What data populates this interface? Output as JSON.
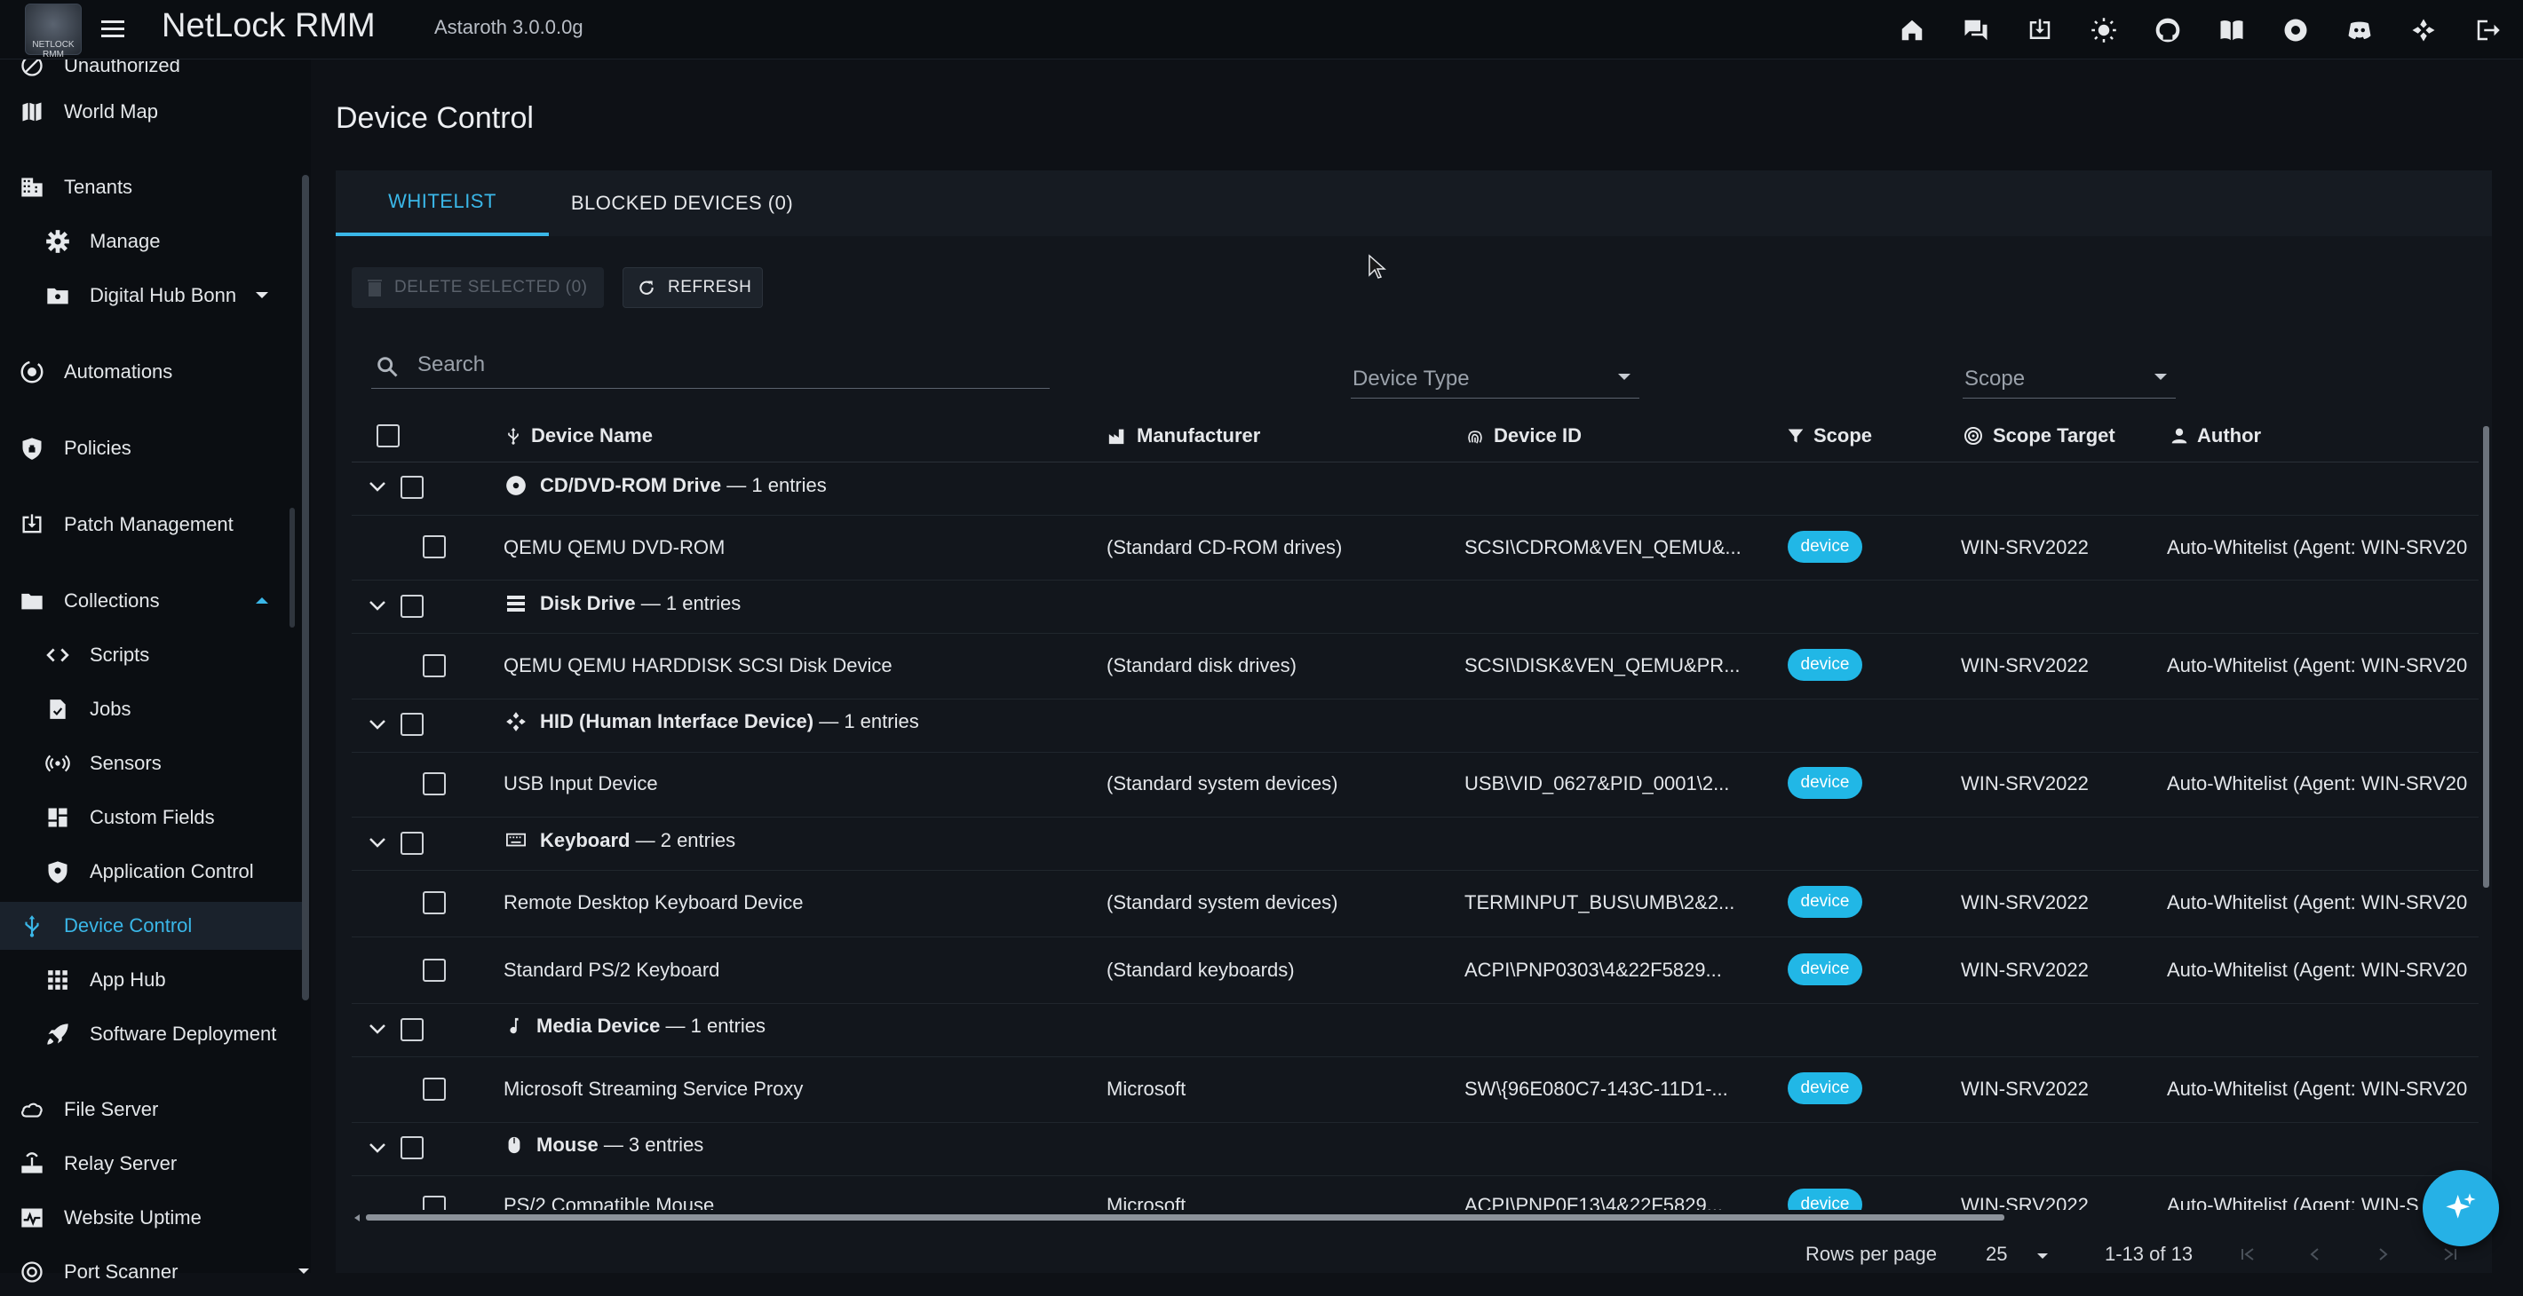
{
  "app": {
    "title": "NetLock RMM",
    "version": "Astaroth 3.0.0.0g",
    "logo_text": "NETLOCK RMM"
  },
  "colors": {
    "accent": "#3ab7e8",
    "badge": "#21b7e6",
    "background": "#0e1116"
  },
  "top_icons": [
    "home-icon",
    "chat-icon",
    "download-icon",
    "theme-icon",
    "github-icon",
    "docs-icon",
    "support-icon",
    "discord-icon",
    "members-icon",
    "logout-icon"
  ],
  "sidebar": {
    "items": [
      {
        "label": "Unauthorized",
        "icon": "unauthorized-icon"
      },
      {
        "label": "World Map",
        "icon": "map-icon"
      },
      {
        "label": "Tenants",
        "icon": "building-icon"
      },
      {
        "label": "Manage",
        "icon": "gear-icon"
      },
      {
        "label": "Digital Hub Bonn",
        "icon": "folder-icon"
      },
      {
        "label": "Automations",
        "icon": "automation-icon"
      },
      {
        "label": "Policies",
        "icon": "shield-icon"
      },
      {
        "label": "Patch Management",
        "icon": "patch-icon"
      },
      {
        "label": "Collections",
        "icon": "folder-icon"
      },
      {
        "label": "Scripts",
        "icon": "code-icon"
      },
      {
        "label": "Jobs",
        "icon": "jobs-icon"
      },
      {
        "label": "Sensors",
        "icon": "sensor-icon"
      },
      {
        "label": "Custom Fields",
        "icon": "fields-icon"
      },
      {
        "label": "Application Control",
        "icon": "app-shield-icon"
      },
      {
        "label": "Device Control",
        "icon": "usb-icon"
      },
      {
        "label": "App Hub",
        "icon": "grid-icon"
      },
      {
        "label": "Software Deployment",
        "icon": "rocket-icon"
      },
      {
        "label": "File Server",
        "icon": "cloud-icon"
      },
      {
        "label": "Relay Server",
        "icon": "router-icon"
      },
      {
        "label": "Website Uptime",
        "icon": "uptime-icon"
      },
      {
        "label": "Port Scanner",
        "icon": "radar-icon"
      }
    ]
  },
  "main": {
    "page_title": "Device Control",
    "tabs": [
      {
        "label": "WHITELIST"
      },
      {
        "label": "BLOCKED DEVICES (0)"
      }
    ],
    "delete_button": "DELETE SELECTED (0)",
    "refresh_button": "REFRESH",
    "search_placeholder": "Search",
    "filter_device_type": "Device Type",
    "filter_scope": "Scope"
  },
  "table": {
    "columns": [
      "Device Name",
      "Manufacturer",
      "Device ID",
      "Scope",
      "Scope Target",
      "Author"
    ],
    "groups": [
      {
        "name": "CD/DVD-ROM Drive",
        "count": "— 1 entries"
      },
      {
        "name": "Disk Drive",
        "count": "— 1 entries"
      },
      {
        "name": "HID (Human Interface Device)",
        "count": "— 1 entries"
      },
      {
        "name": "Keyboard",
        "count": "— 2 entries"
      },
      {
        "name": "Media Device",
        "count": "— 1 entries"
      },
      {
        "name": "Mouse",
        "count": "— 3 entries"
      }
    ],
    "rows": [
      {
        "name": "QEMU QEMU DVD-ROM",
        "manufacturer": "(Standard CD-ROM drives)",
        "device_id": "SCSI\\CDROM&VEN_QEMU&...",
        "scope": "device",
        "target": "WIN-SRV2022",
        "author": "Auto-Whitelist (Agent: WIN-SRV20"
      },
      {
        "name": "QEMU QEMU HARDDISK SCSI Disk Device",
        "manufacturer": "(Standard disk drives)",
        "device_id": "SCSI\\DISK&VEN_QEMU&PR...",
        "scope": "device",
        "target": "WIN-SRV2022",
        "author": "Auto-Whitelist (Agent: WIN-SRV20"
      },
      {
        "name": "USB Input Device",
        "manufacturer": "(Standard system devices)",
        "device_id": "USB\\VID_0627&PID_0001\\2...",
        "scope": "device",
        "target": "WIN-SRV2022",
        "author": "Auto-Whitelist (Agent: WIN-SRV20"
      },
      {
        "name": "Remote Desktop Keyboard Device",
        "manufacturer": "(Standard system devices)",
        "device_id": "TERMINPUT_BUS\\UMB\\2&2...",
        "scope": "device",
        "target": "WIN-SRV2022",
        "author": "Auto-Whitelist (Agent: WIN-SRV20"
      },
      {
        "name": "Standard PS/2 Keyboard",
        "manufacturer": "(Standard keyboards)",
        "device_id": "ACPI\\PNP0303\\4&22F5829...",
        "scope": "device",
        "target": "WIN-SRV2022",
        "author": "Auto-Whitelist (Agent: WIN-SRV20"
      },
      {
        "name": "Microsoft Streaming Service Proxy",
        "manufacturer": "Microsoft",
        "device_id": "SW\\{96E080C7-143C-11D1-...",
        "scope": "device",
        "target": "WIN-SRV2022",
        "author": "Auto-Whitelist (Agent: WIN-SRV20"
      },
      {
        "name": "PS/2 Compatible Mouse",
        "manufacturer": "Microsoft",
        "device_id": "ACPI\\PNP0F13\\4&22F5829...",
        "scope": "device",
        "target": "WIN-SRV2022",
        "author": "Auto-Whitelist (Agent: WIN-S"
      }
    ]
  },
  "footer": {
    "rows_per_page_label": "Rows per page",
    "rows_per_page": "25",
    "range": "1-13 of 13"
  }
}
